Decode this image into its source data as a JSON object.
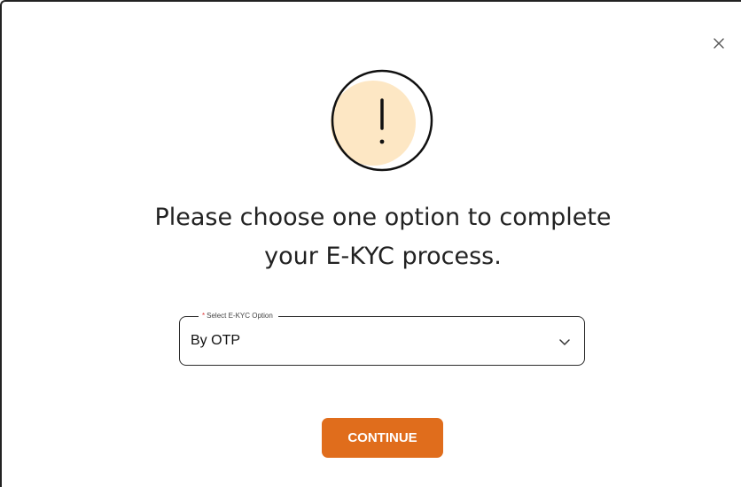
{
  "dialog": {
    "close_icon": "close-icon",
    "alert_icon": "exclamation-icon",
    "title_line1": "Please choose one option to complete",
    "title_line2": "your E-KYC process.",
    "select": {
      "required_mark": "*",
      "label": "Select E-KYC Option",
      "value": "By OTP",
      "dropdown_icon": "chevron-down-icon"
    },
    "continue_label": "CONTINUE"
  },
  "colors": {
    "primary_button": "#e06d1c",
    "alert_fill": "#fde7c4",
    "text": "#222222"
  }
}
